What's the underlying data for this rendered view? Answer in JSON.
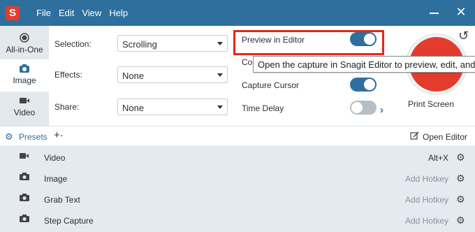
{
  "app": {
    "logo_letter": "S"
  },
  "menu": [
    "File",
    "Edit",
    "View",
    "Help"
  ],
  "window": {
    "minimize": "minimize",
    "close": "✕"
  },
  "modes": [
    {
      "label": "All-in-One",
      "icon": "●",
      "active": false
    },
    {
      "label": "Image",
      "icon": "📷",
      "active": true
    },
    {
      "label": "Video",
      "icon": "■",
      "active": false
    }
  ],
  "settings": {
    "selection_label": "Selection:",
    "selection_value": "Scrolling",
    "effects_label": "Effects:",
    "effects_value": "None",
    "share_label": "Share:",
    "share_value": "None"
  },
  "options": {
    "preview_label": "Preview in Editor",
    "preview_on": true,
    "copy_label": "Co",
    "capture_cursor_label": "Capture Cursor",
    "capture_cursor_on": true,
    "time_delay_label": "Time Delay",
    "time_delay_on": false
  },
  "capture": {
    "label": "Print Screen"
  },
  "tooltip": {
    "text": "Open the capture in Snagit Editor to preview, edit, and"
  },
  "presets": {
    "label": "Presets",
    "add": "+·",
    "open_editor": "Open Editor",
    "rows": [
      {
        "icon": "■",
        "label": "Video",
        "hotkey": "Alt+X",
        "set": true
      },
      {
        "icon": "📷",
        "label": "Image",
        "hotkey": "Add Hotkey",
        "set": false
      },
      {
        "icon": "📷",
        "label": "Grab Text",
        "hotkey": "Add Hotkey",
        "set": false
      },
      {
        "icon": "📷",
        "label": "Step Capture",
        "hotkey": "Add Hotkey",
        "set": false
      }
    ]
  },
  "colors": {
    "titlebar": "#2e6f9e",
    "accent": "#2f6f9f",
    "capture": "#e43c2c",
    "highlight": "#e4271b"
  }
}
